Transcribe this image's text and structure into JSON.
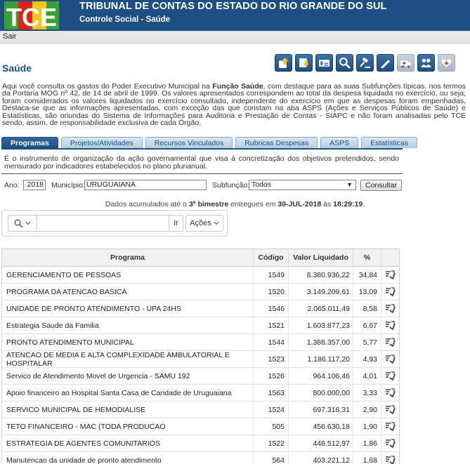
{
  "header": {
    "logo_text": "TCE",
    "title": "TRIBUNAL DE CONTAS DO ESTADO DO RIO GRANDE DO SUL",
    "subtitle": "Controle Social - Saúde"
  },
  "nav": {
    "logout_label": "Sair"
  },
  "page": {
    "title": "Saúde",
    "intro_parts": [
      "Aqui você consulta os gastos do Poder Executivo Municipal na ",
      "Função Saúde",
      ", com destaque para as suas Subfunções típicas, nos termos da Portaria MOG nº 42, de 14 de abril de 1999. Os valores apresentados correspondem ao total da despesa liquidada no exercício, ou seja, foram considerados os valores liquidados no exercício consultado, independente do exercício em que as despesas foram empenhadas. Destaca-se que as informações apresentadas, com exceção das que constam na aba ASPS (Ações e Serviços Públicos de Saúde) e Estatísticas, são oriundas do Sistema de Informações para Auditoria e Prestação de Contas - SIAPC e não foram analisadas pelo TCE sendo, assim, de responsabilidade exclusiva de cada Órgão."
    ]
  },
  "toolbar_icons": [
    "download-up-icon",
    "download-down-icon",
    "report-icon",
    "search-icon",
    "gavel-icon",
    "pencil-icon",
    "ambulance-icon",
    "people-icon",
    "heart-icon"
  ],
  "tabs": [
    {
      "label": "Programas",
      "active": true
    },
    {
      "label": "Projetos/Atividades",
      "active": false
    },
    {
      "label": "Recursos Vinculados",
      "active": false
    },
    {
      "label": "Rubricas Despesas",
      "active": false
    },
    {
      "label": "ASPS",
      "active": false
    },
    {
      "label": "Estatísticas",
      "active": false
    }
  ],
  "tab_description": "É o instrumento de organização da ação governamental que visa à concretização dos objetivos pretendidos, sendo mensurado por indicadores estabelecidos no plano plurianual.",
  "filters": {
    "year_label": "Ano:",
    "year_value": "2018",
    "municipality_label": "Município:",
    "municipality_value": "URUGUAIANA",
    "subfunction_label": "Subfunção:",
    "subfunction_value": "Todos",
    "submit_label": "Consultar"
  },
  "notice": {
    "prefix": "Dados acumulados até o ",
    "period": "3º bimestre",
    "middle": " entregues em ",
    "date": "30-JUL-2018",
    "joiner": " às ",
    "time": "18:29:19",
    "suffix": "."
  },
  "search": {
    "placeholder": "",
    "go_label": "Ir",
    "actions_label": "Ações"
  },
  "table": {
    "columns": [
      "Programa",
      "Código",
      "Valor Liquidado",
      "%"
    ],
    "rows": [
      {
        "programa": "GERENCIAMENTO DE PESSOAS",
        "codigo": "1549",
        "valor": "8.380.936,22",
        "pct": "34,84"
      },
      {
        "programa": "PROGRAMA DA ATENCAO BASICA",
        "codigo": "1520",
        "valor": "3.149.209,61",
        "pct": "13,09"
      },
      {
        "programa": "UNIDADE DE PRONTO ATENDIMENTO - UPA 24HS",
        "codigo": "1546",
        "valor": "2.065.011,49",
        "pct": "8,58"
      },
      {
        "programa": "Estrategia Saude da Familia",
        "codigo": "1521",
        "valor": "1.603.877,23",
        "pct": "6,67"
      },
      {
        "programa": "PRONTO ATENDIMENTO MUNICIPAL",
        "codigo": "1544",
        "valor": "1.388.357,00",
        "pct": "5,77"
      },
      {
        "programa": "ATENCAO DE MEDIA E ALTA COMPLEXIDADE AMBULATORIAL E HOSPITALAR",
        "codigo": "1523",
        "valor": "1.186.117,20",
        "pct": "4,93"
      },
      {
        "programa": "Servico de Atendimento Movel de Urgencia - SAMU 192",
        "codigo": "1526",
        "valor": "964.106,46",
        "pct": "4,01"
      },
      {
        "programa": "Apoio financeiro ao Hospital Santa Casa de Caridade de Uruguaiana",
        "codigo": "1563",
        "valor": "800.000,00",
        "pct": "3,33"
      },
      {
        "programa": "SERVICO MUNICIPAL DE HEMODIALISE",
        "codigo": "1524",
        "valor": "697.316,31",
        "pct": "2,90"
      },
      {
        "programa": "TETO FINANCEIRO - MAC (TODA PRODUCAO",
        "codigo": "505",
        "valor": "456.630,18",
        "pct": "1,90"
      },
      {
        "programa": "ESTRATEGIA DE AGENTES COMUNITARIOS",
        "codigo": "1522",
        "valor": "446.512,97",
        "pct": "1,86"
      },
      {
        "programa": "Manutencao da unidade de pronto atendimento",
        "codigo": "564",
        "valor": "403.221,12",
        "pct": "1,68"
      }
    ]
  },
  "colors": {
    "header_bg": "#1d4f85",
    "accent": "#1d4f85",
    "logo_green": "#3aa235",
    "logo_red": "#d9261c",
    "logo_yellow": "#f4c51a"
  }
}
